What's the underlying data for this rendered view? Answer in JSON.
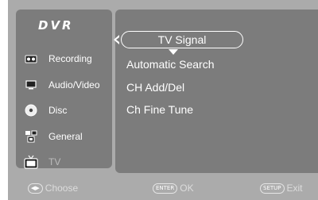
{
  "brand": "DVR",
  "sidebar": {
    "items": [
      {
        "label": "Recording",
        "icon": "recording-icon"
      },
      {
        "label": "Audio/Video",
        "icon": "monitor-icon"
      },
      {
        "label": "Disc",
        "icon": "disc-icon"
      },
      {
        "label": "General",
        "icon": "settings-icon"
      },
      {
        "label": "TV",
        "icon": "tv-icon"
      }
    ]
  },
  "menu": {
    "selected": "TV Signal",
    "items": [
      "Automatic Search",
      "CH Add/Del",
      "Ch Fine Tune"
    ]
  },
  "hints": {
    "choose_key": "◀▶",
    "choose": "Choose",
    "ok_key": "ENTER",
    "ok": "OK",
    "exit_key": "SETUP",
    "exit": "Exit"
  },
  "colors": {
    "panel": "#7c7c7c",
    "background": "#ababab",
    "text": "#ffffff"
  }
}
